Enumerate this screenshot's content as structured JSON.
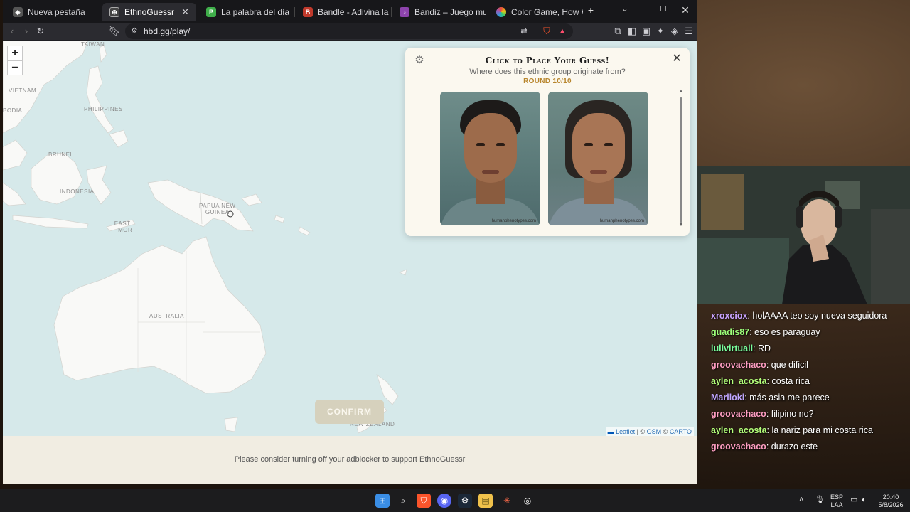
{
  "browser": {
    "tabs": [
      {
        "title": "Nueva pestaña",
        "active": false
      },
      {
        "title": "EthnoGuessr",
        "active": true
      },
      {
        "title": "La palabra del día",
        "active": false
      },
      {
        "title": "Bandle - Adivina la canción, u",
        "active": false
      },
      {
        "title": "Bandiz – Juego musical diari",
        "active": false
      },
      {
        "title": "Color Game, How Well Can Y",
        "active": false
      }
    ],
    "new_tab_label": "+",
    "url": "hbd.gg/play/"
  },
  "map": {
    "zoom_in": "+",
    "zoom_out": "−",
    "labels": {
      "taiwan": "TAIWAN",
      "vietnam": "VIETNAM",
      "bodia": "BODIA",
      "philippines": "PHILIPPINES",
      "brunei": "BRUNEI",
      "indonesia": "INDONESIA",
      "png": "PAPUA NEW\nGUINEA",
      "east_timor": "EAST\nTIMOR",
      "australia": "AUSTRALIA",
      "new_zealand": "NEW ZEALAND"
    },
    "attribution": {
      "leaflet": "Leaflet",
      "sep1": " | © ",
      "osm": "OSM",
      "sep2": " © ",
      "carto": "CARTO"
    }
  },
  "game": {
    "title": "Click to Place Your Guess!",
    "subtitle": "Where does this ethnic group originate from?",
    "round": "ROUND 10/10",
    "confirm": "CONFIRM",
    "photo_watermark_1": "humanphenotypes.com",
    "photo_watermark_2": "humanphenotypes.com"
  },
  "footer": {
    "adblock_message": "Please consider turning off your adblocker to support EthnoGuessr"
  },
  "chat": [
    {
      "user": "xroxciox",
      "color": "#c9a3ff",
      "message": ": holAAAA teo soy nueva seguidora"
    },
    {
      "user": "guadis87",
      "color": "#9dff7a",
      "message": ": eso es paraguay"
    },
    {
      "user": "lulivirtuall",
      "color": "#7aff9d",
      "message": ": RD"
    },
    {
      "user": "groovachaco",
      "color": "#ff9ec2",
      "message": ": que dificil"
    },
    {
      "user": "aylen_acosta",
      "color": "#b3ff7a",
      "message": ": costa rica"
    },
    {
      "user": "Mariloki",
      "color": "#c0a6ff",
      "message": ": más asia me parece"
    },
    {
      "user": "groovachaco",
      "color": "#ff9ec2",
      "message": ": filipino no?"
    },
    {
      "user": "aylen_acosta",
      "color": "#b3ff7a",
      "message": ": la nariz para mi costa rica"
    },
    {
      "user": "groovachaco",
      "color": "#ff9ec2",
      "message": ": durazo este"
    }
  ],
  "taskbar": {
    "lang_top": "ESP",
    "lang_bottom": "LAA",
    "time": "20:40",
    "date": "5/8/2026"
  }
}
